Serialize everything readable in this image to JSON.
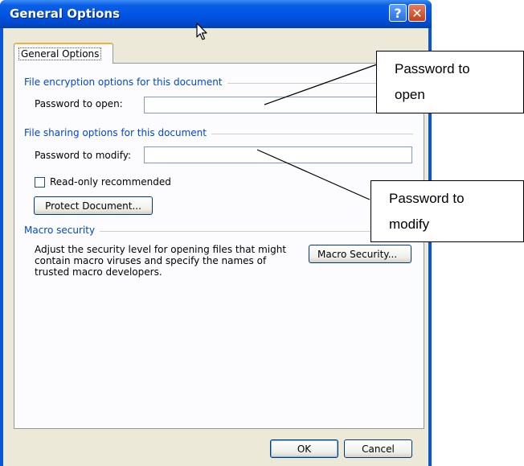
{
  "window": {
    "title": "General Options",
    "help_glyph": "?",
    "close_glyph": "✕"
  },
  "tab": {
    "label": "General Options"
  },
  "encryption": {
    "heading": "File encryption options for this document",
    "password_open_label": "Password to open:",
    "password_open_value": ""
  },
  "sharing": {
    "heading": "File sharing options for this document",
    "password_modify_label": "Password to modify:",
    "password_modify_value": "",
    "read_only_label": "Read-only recommended",
    "read_only_checked": false,
    "protect_button": "Protect Document..."
  },
  "macro": {
    "heading": "Macro security",
    "description": "Adjust the security level for opening files that might contain macro viruses and specify the names of trusted macro developers.",
    "button": "Macro Security..."
  },
  "footer": {
    "ok": "OK",
    "cancel": "Cancel"
  },
  "callouts": {
    "open_line1": "Password to",
    "open_line2": "open",
    "modify_line1": "Password to",
    "modify_line2": "modify"
  },
  "colors": {
    "titlebar": "#0054e3",
    "section_heading": "#0046d5",
    "tab_highlight": "#f1b03a",
    "dialog_bg": "#ece9d8"
  }
}
